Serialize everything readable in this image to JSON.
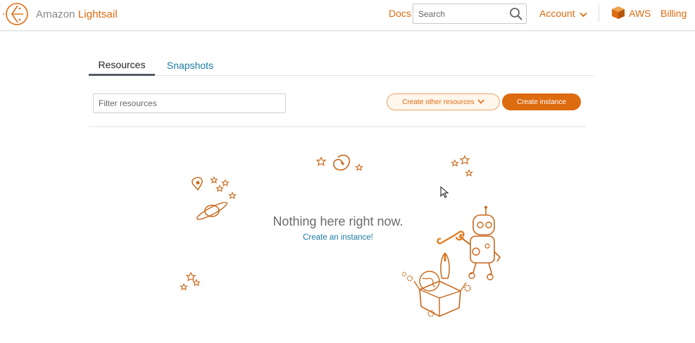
{
  "header": {
    "logo_prefix": "Amazon ",
    "logo_brand": "Lightsail",
    "docs_label": "Docs",
    "search_placeholder": "Search",
    "account_label": "Account",
    "aws_label": "AWS",
    "billing_label": "Billing"
  },
  "tabs": [
    {
      "label": "Resources",
      "active": true
    },
    {
      "label": "Snapshots",
      "active": false
    }
  ],
  "toolbar": {
    "filter_placeholder": "Filter resources",
    "create_other_label": "Create other resources",
    "create_instance_label": "Create instance"
  },
  "empty_state": {
    "title": "Nothing here right now.",
    "link": "Create an instance!"
  },
  "icons": {
    "logo": "lightsail-logo-icon",
    "search": "search-icon",
    "account_chevron": "chevron-down-icon",
    "aws": "aws-cube-icon",
    "create_other_chevron": "chevron-down-icon"
  },
  "colors": {
    "accent": "#dd6b10",
    "link": "#1b7aa3",
    "text_muted": "#6b6b6b"
  }
}
